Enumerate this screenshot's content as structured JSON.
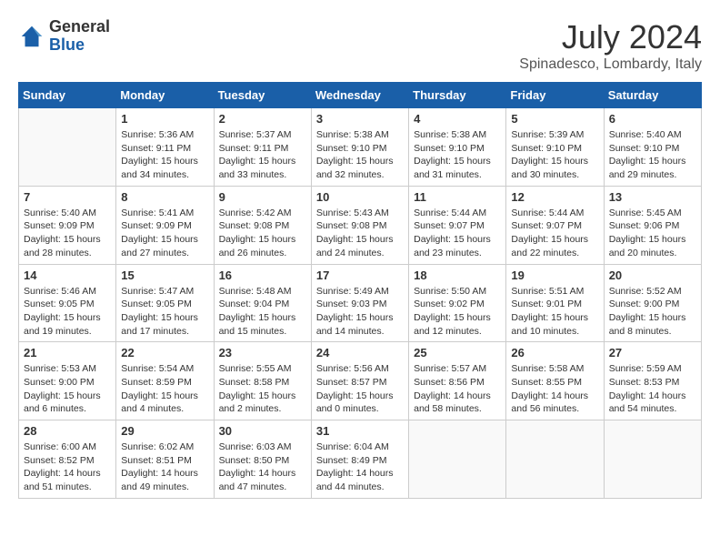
{
  "header": {
    "logo_general": "General",
    "logo_blue": "Blue",
    "title": "July 2024",
    "subtitle": "Spinadesco, Lombardy, Italy"
  },
  "days_of_week": [
    "Sunday",
    "Monday",
    "Tuesday",
    "Wednesday",
    "Thursday",
    "Friday",
    "Saturday"
  ],
  "weeks": [
    [
      {
        "day": "",
        "info": ""
      },
      {
        "day": "1",
        "info": "Sunrise: 5:36 AM\nSunset: 9:11 PM\nDaylight: 15 hours\nand 34 minutes."
      },
      {
        "day": "2",
        "info": "Sunrise: 5:37 AM\nSunset: 9:11 PM\nDaylight: 15 hours\nand 33 minutes."
      },
      {
        "day": "3",
        "info": "Sunrise: 5:38 AM\nSunset: 9:10 PM\nDaylight: 15 hours\nand 32 minutes."
      },
      {
        "day": "4",
        "info": "Sunrise: 5:38 AM\nSunset: 9:10 PM\nDaylight: 15 hours\nand 31 minutes."
      },
      {
        "day": "5",
        "info": "Sunrise: 5:39 AM\nSunset: 9:10 PM\nDaylight: 15 hours\nand 30 minutes."
      },
      {
        "day": "6",
        "info": "Sunrise: 5:40 AM\nSunset: 9:10 PM\nDaylight: 15 hours\nand 29 minutes."
      }
    ],
    [
      {
        "day": "7",
        "info": "Sunrise: 5:40 AM\nSunset: 9:09 PM\nDaylight: 15 hours\nand 28 minutes."
      },
      {
        "day": "8",
        "info": "Sunrise: 5:41 AM\nSunset: 9:09 PM\nDaylight: 15 hours\nand 27 minutes."
      },
      {
        "day": "9",
        "info": "Sunrise: 5:42 AM\nSunset: 9:08 PM\nDaylight: 15 hours\nand 26 minutes."
      },
      {
        "day": "10",
        "info": "Sunrise: 5:43 AM\nSunset: 9:08 PM\nDaylight: 15 hours\nand 24 minutes."
      },
      {
        "day": "11",
        "info": "Sunrise: 5:44 AM\nSunset: 9:07 PM\nDaylight: 15 hours\nand 23 minutes."
      },
      {
        "day": "12",
        "info": "Sunrise: 5:44 AM\nSunset: 9:07 PM\nDaylight: 15 hours\nand 22 minutes."
      },
      {
        "day": "13",
        "info": "Sunrise: 5:45 AM\nSunset: 9:06 PM\nDaylight: 15 hours\nand 20 minutes."
      }
    ],
    [
      {
        "day": "14",
        "info": "Sunrise: 5:46 AM\nSunset: 9:05 PM\nDaylight: 15 hours\nand 19 minutes."
      },
      {
        "day": "15",
        "info": "Sunrise: 5:47 AM\nSunset: 9:05 PM\nDaylight: 15 hours\nand 17 minutes."
      },
      {
        "day": "16",
        "info": "Sunrise: 5:48 AM\nSunset: 9:04 PM\nDaylight: 15 hours\nand 15 minutes."
      },
      {
        "day": "17",
        "info": "Sunrise: 5:49 AM\nSunset: 9:03 PM\nDaylight: 15 hours\nand 14 minutes."
      },
      {
        "day": "18",
        "info": "Sunrise: 5:50 AM\nSunset: 9:02 PM\nDaylight: 15 hours\nand 12 minutes."
      },
      {
        "day": "19",
        "info": "Sunrise: 5:51 AM\nSunset: 9:01 PM\nDaylight: 15 hours\nand 10 minutes."
      },
      {
        "day": "20",
        "info": "Sunrise: 5:52 AM\nSunset: 9:00 PM\nDaylight: 15 hours\nand 8 minutes."
      }
    ],
    [
      {
        "day": "21",
        "info": "Sunrise: 5:53 AM\nSunset: 9:00 PM\nDaylight: 15 hours\nand 6 minutes."
      },
      {
        "day": "22",
        "info": "Sunrise: 5:54 AM\nSunset: 8:59 PM\nDaylight: 15 hours\nand 4 minutes."
      },
      {
        "day": "23",
        "info": "Sunrise: 5:55 AM\nSunset: 8:58 PM\nDaylight: 15 hours\nand 2 minutes."
      },
      {
        "day": "24",
        "info": "Sunrise: 5:56 AM\nSunset: 8:57 PM\nDaylight: 15 hours\nand 0 minutes."
      },
      {
        "day": "25",
        "info": "Sunrise: 5:57 AM\nSunset: 8:56 PM\nDaylight: 14 hours\nand 58 minutes."
      },
      {
        "day": "26",
        "info": "Sunrise: 5:58 AM\nSunset: 8:55 PM\nDaylight: 14 hours\nand 56 minutes."
      },
      {
        "day": "27",
        "info": "Sunrise: 5:59 AM\nSunset: 8:53 PM\nDaylight: 14 hours\nand 54 minutes."
      }
    ],
    [
      {
        "day": "28",
        "info": "Sunrise: 6:00 AM\nSunset: 8:52 PM\nDaylight: 14 hours\nand 51 minutes."
      },
      {
        "day": "29",
        "info": "Sunrise: 6:02 AM\nSunset: 8:51 PM\nDaylight: 14 hours\nand 49 minutes."
      },
      {
        "day": "30",
        "info": "Sunrise: 6:03 AM\nSunset: 8:50 PM\nDaylight: 14 hours\nand 47 minutes."
      },
      {
        "day": "31",
        "info": "Sunrise: 6:04 AM\nSunset: 8:49 PM\nDaylight: 14 hours\nand 44 minutes."
      },
      {
        "day": "",
        "info": ""
      },
      {
        "day": "",
        "info": ""
      },
      {
        "day": "",
        "info": ""
      }
    ]
  ]
}
